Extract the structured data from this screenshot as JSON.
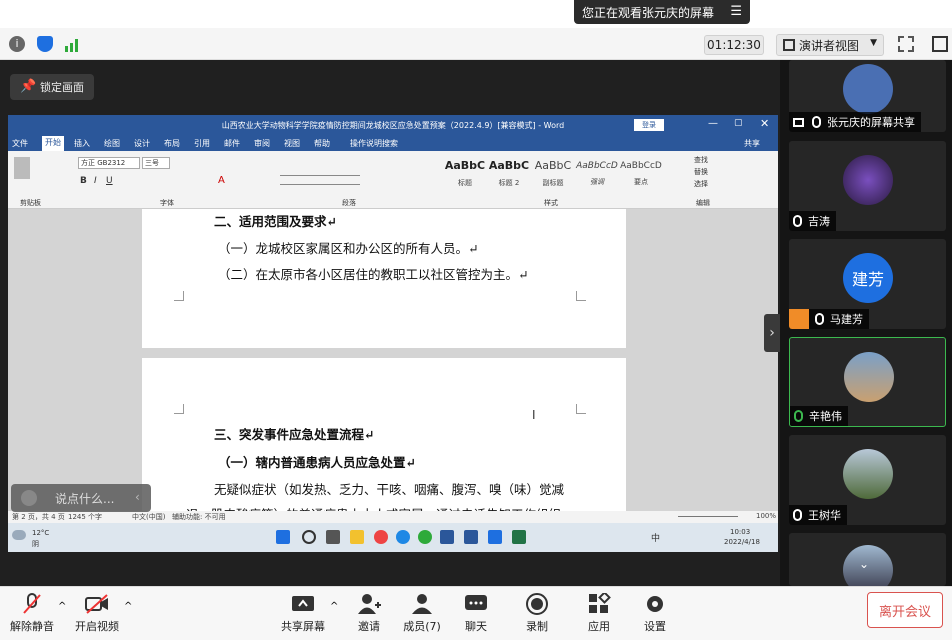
{
  "top": {
    "viewing_text": "您正在观看张元庆的屏幕",
    "timer": "01:12:30",
    "view_mode": "演讲者视图",
    "lock_label": "锁定画面"
  },
  "word": {
    "title": "山西农业大学动物科学学院疫情防控期间龙城校区应急处置预案（2022.4.9）[兼容模式] - Word",
    "login": "登录",
    "tabs": [
      "文件",
      "开始",
      "插入",
      "绘图",
      "设计",
      "布局",
      "引用",
      "邮件",
      "审阅",
      "视图",
      "帮助",
      "操作说明搜索",
      "共享"
    ],
    "font_name": "方正 GB2312",
    "font_size": "三号",
    "styles": [
      {
        "sample": "AaBbC",
        "name": "标题"
      },
      {
        "sample": "AaBbC",
        "name": "标题 2"
      },
      {
        "sample": "AaBbC",
        "name": "副标题"
      },
      {
        "sample": "AaBbCcD",
        "name": "强调"
      },
      {
        "sample": "AaBbCcD",
        "name": "要点"
      }
    ],
    "ribbon_groups": [
      "剪贴板",
      "字体",
      "段落",
      "样式",
      "编辑"
    ],
    "edit_items": [
      "查找",
      "替换",
      "选择"
    ],
    "doc": {
      "l1": "二、适用范围及要求↵",
      "l2": "（一）龙城校区家属区和办公区的所有人员。↵",
      "l3": "（二）在太原市各小区居住的教职工以社区管控为主。↵",
      "l4": "三、突发事件应急处置流程↵",
      "l5": "（一）辖内普通患病人员应急处置↵",
      "l6": "无疑似症状（如发热、乏力、干咳、咽痛、腹泻、嗅（味）觉减",
      "l7": "退、肌肉酸痛等）的普通病患由本人或家属，通过电话告知工作组织"
    },
    "status": {
      "page": "第 2 页，共 4 页",
      "words": "1245 个字",
      "lang": "中文(中国)",
      "access": "辅助功能: 不可用",
      "zoom": "100%"
    },
    "taskbar": {
      "weather": "12°C",
      "weather2": "阴",
      "ime": "中",
      "time": "10:03",
      "date": "2022/4/18"
    }
  },
  "chat_placeholder": "说点什么...",
  "participants": [
    {
      "name": "张元庆的屏幕共享",
      "muted": false
    },
    {
      "name": "吉涛",
      "muted": true
    },
    {
      "name": "马建芳",
      "muted": true,
      "avatar_text": "建芳"
    },
    {
      "name": "辛艳伟",
      "muted": false
    },
    {
      "name": "王树华",
      "muted": true
    },
    {
      "name": "",
      "muted": false
    }
  ],
  "bottom": {
    "unmute": "解除静音",
    "video": "开启视频",
    "share": "共享屏幕",
    "invite": "邀请",
    "members": "成员(7)",
    "chat": "聊天",
    "record": "录制",
    "apps": "应用",
    "settings": "设置",
    "leave": "离开会议"
  },
  "colors": {
    "word_blue": "#2b579a",
    "accent_green": "#3cb94f",
    "leave_red": "#d9534f",
    "avatar_blue": "#1e6fe0"
  }
}
